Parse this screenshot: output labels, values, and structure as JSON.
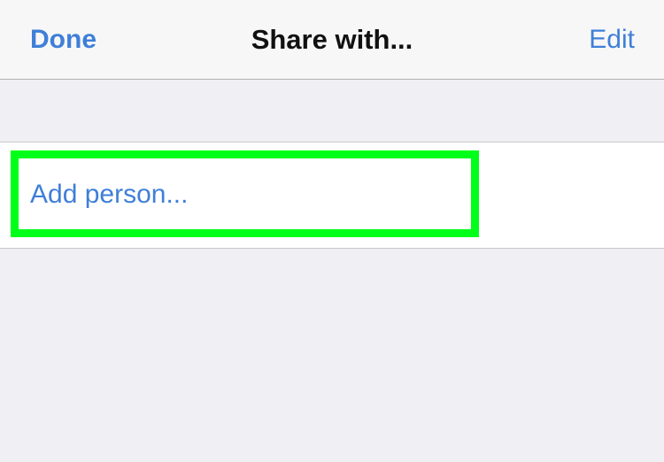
{
  "nav": {
    "done_label": "Done",
    "title": "Share with...",
    "edit_label": "Edit"
  },
  "list": {
    "add_person_label": "Add person..."
  },
  "colors": {
    "accent": "#3f7fd8",
    "highlight": "#00ff19",
    "background": "#efeff4"
  }
}
